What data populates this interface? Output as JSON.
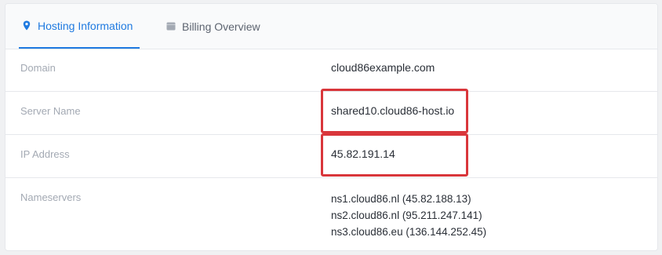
{
  "tabs": [
    {
      "label": "Hosting Information",
      "icon": "map-pin-icon",
      "active": true
    },
    {
      "label": "Billing Overview",
      "icon": "folder-icon",
      "active": false
    }
  ],
  "rows": {
    "domain": {
      "label": "Domain",
      "value": "cloud86example.com"
    },
    "server_name": {
      "label": "Server Name",
      "value": "shared10.cloud86-host.io"
    },
    "ip_address": {
      "label": "IP Address",
      "value": "45.82.191.14"
    },
    "nameservers": {
      "label": "Nameservers",
      "values": [
        "ns1.cloud86.nl (45.82.188.13)",
        "ns2.cloud86.nl (95.211.247.141)",
        "ns3.cloud86.eu (136.144.252.45)"
      ]
    }
  },
  "colors": {
    "accent": "#1f7ae0",
    "highlight": "#d9363b"
  }
}
